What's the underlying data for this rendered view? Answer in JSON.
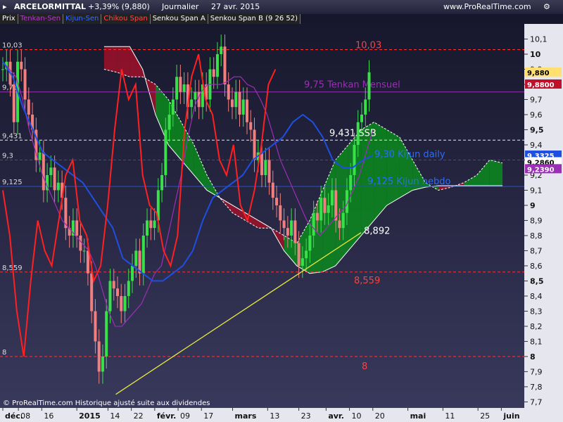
{
  "header": {
    "symbol": "ARCELORMITTAL",
    "change": "+3,39% (9,880)",
    "period": "Journalier",
    "date": "27 avr. 2015",
    "site": "www.ProRealTime.com"
  },
  "legend": [
    {
      "label": "Prix",
      "color": "#ffffff"
    },
    {
      "label": "Tenkan-Sen",
      "color": "#9b2fb5"
    },
    {
      "label": "Kijun-Sen",
      "color": "#1f4fe0"
    },
    {
      "label": "Chikou Span",
      "color": "#ff3030"
    },
    {
      "label": "Senkou Span A",
      "color": "#ffffff"
    },
    {
      "label": "Senkou Span B (9 26 52)",
      "color": "#ffffff"
    }
  ],
  "footer": "© ProRealTime.com  Historique ajusté suite aux dividendes",
  "colors": {
    "background_top": "#15152a",
    "background_bottom": "#3a3a5e",
    "up_candle": "#39e04a",
    "down_candle": "#f08080",
    "tenkan": "#9b2fb5",
    "kijun": "#1f4fe0",
    "chikou": "#ff2020",
    "cloud_bull": "#0a8a1c",
    "cloud_bear": "#a0102a",
    "trendline": "#e8e840",
    "level_line_red": "#ff3030",
    "level_line_white": "#e8e8e8"
  },
  "chart_data": {
    "type": "candlestick",
    "ylim": [
      7.66,
      10.2
    ],
    "yticks": [
      "7,7",
      "7,8",
      "7,9",
      "8",
      "8,1",
      "8,2",
      "8,3",
      "8,4",
      "8,5",
      "8,6",
      "8,7",
      "8,8",
      "8,9",
      "9",
      "9,1",
      "9,2",
      "9,3",
      "9,4",
      "9,5",
      "9,6",
      "9,7",
      "9,8",
      "9,9",
      "10",
      "10,1"
    ],
    "yticks_values": [
      7.7,
      7.8,
      7.9,
      8.0,
      8.1,
      8.2,
      8.3,
      8.4,
      8.5,
      8.6,
      8.7,
      8.8,
      8.9,
      9.0,
      9.1,
      9.2,
      9.3,
      9.4,
      9.5,
      9.6,
      9.7,
      9.8,
      9.9,
      10.0,
      10.1
    ],
    "xticks": [
      {
        "label": "déc.",
        "index": 0
      },
      {
        "label": "08",
        "index": 4
      },
      {
        "label": "16",
        "index": 10
      },
      {
        "label": "2015",
        "index": 19
      },
      {
        "label": "14",
        "index": 27
      },
      {
        "label": "22",
        "index": 33
      },
      {
        "label": "févr.",
        "index": 39
      },
      {
        "label": "09",
        "index": 45
      },
      {
        "label": "17",
        "index": 51
      },
      {
        "label": "mars",
        "index": 59
      },
      {
        "label": "13",
        "index": 68
      },
      {
        "label": "23",
        "index": 76
      },
      {
        "label": "avr.",
        "index": 83
      },
      {
        "label": "10",
        "index": 89
      },
      {
        "label": "20",
        "index": 95
      },
      {
        "label": "mai",
        "index": 104
      },
      {
        "label": "11",
        "index": 113
      },
      {
        "label": "25",
        "index": 122
      },
      {
        "label": "juin",
        "index": 128
      }
    ],
    "price_index_range": [
      0,
      131
    ],
    "candle_count": 100,
    "price_path": [
      9.9,
      9.95,
      9.8,
      9.55,
      9.95,
      9.9,
      9.7,
      9.6,
      9.5,
      9.3,
      9.35,
      9.1,
      9.2,
      9.25,
      9.1,
      9.15,
      9.05,
      8.85,
      8.8,
      8.9,
      8.8,
      8.7,
      8.7,
      8.55,
      8.3,
      8.1,
      7.9,
      8.0,
      8.3,
      8.5,
      8.45,
      8.4,
      8.3,
      8.4,
      8.5,
      8.6,
      8.7,
      8.55,
      8.8,
      8.9,
      8.85,
      8.9,
      9.1,
      9.2,
      9.5,
      9.6,
      9.7,
      9.85,
      9.75,
      9.8,
      9.65,
      9.7,
      9.75,
      9.65,
      9.8,
      9.7,
      9.9,
      9.85,
      10.0,
      10.05,
      9.8,
      9.7,
      9.65,
      9.75,
      9.6,
      9.7,
      9.55,
      9.5,
      9.3,
      9.35,
      9.2,
      9.3,
      9.15,
      9.05,
      9.0,
      8.9,
      8.85,
      8.8,
      8.9,
      8.75,
      8.6,
      8.65,
      8.7,
      8.8,
      8.95,
      8.9,
      9.05,
      8.95,
      9.0,
      9.1,
      8.9,
      8.85,
      8.95,
      9.1,
      9.2,
      9.4,
      9.55,
      9.6,
      9.7,
      9.88
    ],
    "tenkan": [
      9.95,
      9.9,
      9.85,
      9.7,
      9.5,
      9.35,
      9.2,
      9.1,
      9.0,
      8.9,
      8.85,
      8.8,
      8.75,
      8.7,
      8.6,
      8.45,
      8.3,
      8.2,
      8.2,
      8.25,
      8.3,
      8.35,
      8.45,
      8.55,
      8.6,
      8.8,
      9.0,
      9.2,
      9.45,
      9.65,
      9.75,
      9.8,
      9.8,
      9.8,
      9.82,
      9.85,
      9.85,
      9.8,
      9.78,
      9.7,
      9.6,
      9.45,
      9.3,
      9.2,
      9.1,
      9.0,
      8.9,
      8.85,
      8.8,
      8.85,
      8.9,
      8.95,
      9.0,
      9.1,
      9.2,
      9.35,
      9.5
    ],
    "kijun": [
      9.95,
      9.85,
      9.65,
      9.5,
      9.35,
      9.3,
      9.25,
      9.2,
      9.15,
      9.05,
      8.95,
      8.85,
      8.65,
      8.6,
      8.55,
      8.5,
      8.5,
      8.55,
      8.6,
      8.7,
      8.9,
      9.05,
      9.1,
      9.15,
      9.2,
      9.3,
      9.35,
      9.4,
      9.45,
      9.55,
      9.6,
      9.55,
      9.45,
      9.3,
      9.25,
      9.25,
      9.3,
      9.33
    ],
    "chikou": [
      9.1,
      8.8,
      8.3,
      8.0,
      8.5,
      8.9,
      8.7,
      8.6,
      8.9,
      9.2,
      9.3,
      8.9,
      8.8,
      8.5,
      8.6,
      9.0,
      9.5,
      9.9,
      9.7,
      9.8,
      9.2,
      9.0,
      8.95,
      8.7,
      8.6,
      8.8,
      9.5,
      9.85,
      10.0,
      9.7,
      9.6,
      9.3,
      9.2,
      9.4,
      9.0,
      8.9,
      9.1,
      9.4,
      9.8,
      9.9
    ],
    "senkou_a_label": "Senkou Span A",
    "senkou_b_label": "Senkou Span B (9 26 52)",
    "levels": [
      {
        "value": 10.03,
        "label": "10,03",
        "left_label": "10,03",
        "style": "red-dashed"
      },
      {
        "value": 9.75,
        "label": "9,75 Tenkan Mensuel",
        "left_label": "9,75",
        "style": "purple"
      },
      {
        "value": 9.431,
        "label": "9,431 SSB",
        "left_label": "9,431",
        "style": "white-dashed"
      },
      {
        "value": 9.3,
        "label": "9,30 Kijun daily",
        "left_label": "9,3",
        "style": "blue-dashed"
      },
      {
        "value": 9.125,
        "label": "9,125 Kijun hebdo",
        "left_label": "9,125",
        "style": "blue"
      },
      {
        "value": 8.559,
        "label": "8,559",
        "left_label": "8,559",
        "style": "red-dashed"
      },
      {
        "value": 8.0,
        "label": "8",
        "left_label": "8",
        "style": "red-dashed"
      }
    ],
    "trendline": {
      "start_index": 29,
      "start_value": 7.75,
      "end_index": 92,
      "end_value": 8.82,
      "label": "8,892"
    },
    "price_tags": [
      {
        "value": 9.88,
        "label": "9,880",
        "bg": "#ffe070",
        "fg": "#000"
      },
      {
        "value": 9.8,
        "label": "9,8800",
        "bg": "#c0102a",
        "fg": "#fff"
      },
      {
        "value": 9.33,
        "label": "9,3325",
        "bg": "#1f4fe0",
        "fg": "#fff"
      },
      {
        "value": 9.286,
        "label": "9,2860",
        "bg": "#ffffff",
        "fg": "#000"
      },
      {
        "value": 9.24,
        "label": "9,2390",
        "bg": "#9b2fb5",
        "fg": "#fff"
      }
    ]
  }
}
